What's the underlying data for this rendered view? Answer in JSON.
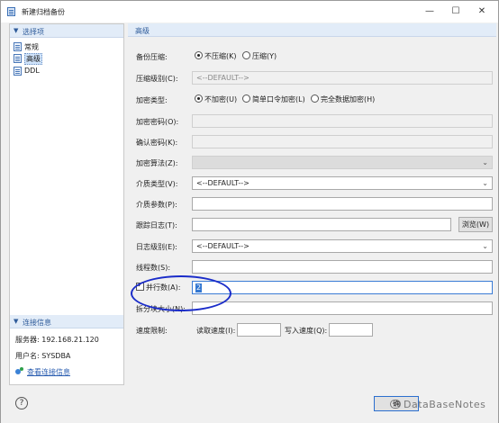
{
  "window": {
    "title": "新建归档备份",
    "minimize": "—",
    "maximize": "☐",
    "close": "✕"
  },
  "sidebar": {
    "options_header": "选择项",
    "items": [
      {
        "label": "常规",
        "selected": false
      },
      {
        "label": "高级",
        "selected": true
      },
      {
        "label": "DDL",
        "selected": false
      }
    ],
    "connection_header": "连接信息",
    "server_label": "服务器: 192.168.21.120",
    "user_label": "用户名: SYSDBA",
    "view_connection_link": "查看连接信息"
  },
  "main": {
    "header": "高级",
    "backup_compress": {
      "label": "备份压缩:",
      "options": [
        "不压缩(K)",
        "压缩(Y)"
      ],
      "selected": "不压缩(K)"
    },
    "compress_level": {
      "label": "压缩级别(C):",
      "value": "<--DEFAULT-->"
    },
    "encrypt_type": {
      "label": "加密类型:",
      "options": [
        "不加密(U)",
        "简单口令加密(L)",
        "完全数据加密(H)"
      ],
      "selected": "不加密(U)"
    },
    "encrypt_password": {
      "label": "加密密码(O):",
      "value": ""
    },
    "confirm_password": {
      "label": "确认密码(K):",
      "value": ""
    },
    "encrypt_algorithm": {
      "label": "加密算法(Z):",
      "value": ""
    },
    "media_type": {
      "label": "介质类型(V):",
      "value": "<--DEFAULT-->"
    },
    "media_params": {
      "label": "介质参数(P):",
      "value": ""
    },
    "trace_log": {
      "label": "跟踪日志(T):",
      "value": "",
      "browse": "浏览(W)"
    },
    "log_level": {
      "label": "日志级别(E):",
      "value": "<--DEFAULT-->"
    },
    "thread_count": {
      "label": "线程数(S):",
      "value": ""
    },
    "parallel_count": {
      "label": "并行数(A):",
      "value": "2",
      "checked": true
    },
    "split_size": {
      "label": "拆分块大小(N):",
      "value": ""
    },
    "speed_limit": {
      "label": "速度限制:",
      "read_label": "读取速度(I):",
      "write_label": "写入速度(Q):",
      "read_value": "",
      "write_value": ""
    }
  },
  "footer": {
    "help": "?",
    "ok_partial": "确",
    "watermark": "DataBaseNotes"
  },
  "colors": {
    "accent": "#2e5b9a",
    "annotation_circle": "#1a2cc9",
    "selection": "#3377d1"
  }
}
